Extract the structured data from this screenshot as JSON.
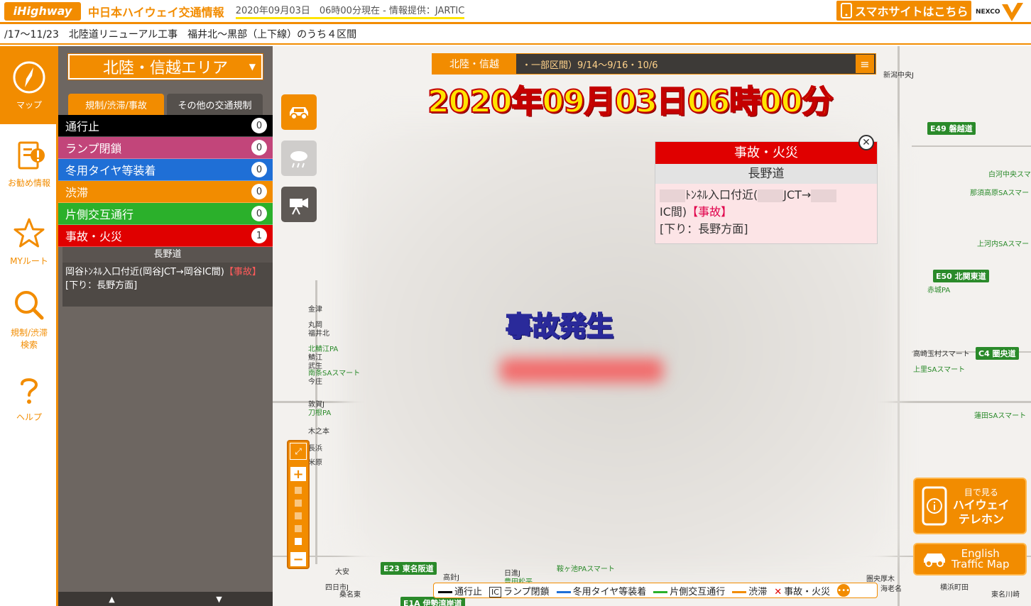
{
  "header": {
    "logo": "iHighway",
    "title": "中日本ハイウェイ交通情報",
    "timestamp": "2020年09月03日　06時00分現在 - 情報提供：JARTIC",
    "smartphone_link": "スマホサイトはこちら",
    "nexco": "NEXCO"
  },
  "ticker": {
    "text": "/17～11/23　北陸道リニューアル工事　福井北～黒部（上下線）のうち４区間"
  },
  "nav": {
    "items": [
      {
        "label": "マップ",
        "icon": "compass-icon"
      },
      {
        "label": "お勧め情報",
        "icon": "info-icon"
      },
      {
        "label": "MYルート",
        "icon": "star-icon"
      },
      {
        "label": "規制/渋滞\n検索",
        "icon": "search-icon"
      },
      {
        "label": "ヘルプ",
        "icon": "help-icon"
      }
    ]
  },
  "panel": {
    "area_label": "北陸・信越エリア",
    "tabs": [
      "規制/渋滞/事故",
      "その他の交通規制"
    ],
    "categories": [
      {
        "label": "通行止",
        "count": "0",
        "color": "#000000"
      },
      {
        "label": "ランプ閉鎖",
        "count": "0",
        "color": "#c2457a"
      },
      {
        "label": "冬用タイヤ等装着",
        "count": "0",
        "color": "#1f6fd6"
      },
      {
        "label": "渋滞",
        "count": "0",
        "color": "#f28c00"
      },
      {
        "label": "片側交互通行",
        "count": "0",
        "color": "#2bb02b"
      },
      {
        "label": "事故・火災",
        "count": "1",
        "color": "#e00000"
      }
    ],
    "incident": {
      "road": "長野道",
      "line1": "岡谷ﾄﾝﾈﾙ入口付近(岡谷JCT→岡谷IC間)",
      "tag": "【事故】",
      "line2": "[下り：長野方面]"
    },
    "scroll_up": "▲",
    "scroll_down": "▼"
  },
  "map": {
    "region_label": "北陸・信越",
    "region_text": "・一部区間）9/14～9/16・10/6",
    "big_time": "2020年09月03日06時00分",
    "accident_label": "事故発生",
    "popup": {
      "title": "事故・火災",
      "road": "長野道",
      "line1": "ﾄﾝﾈﾙ入口付近(",
      "line1b": "JCT→",
      "line2": "IC間)",
      "tag": "【事故】",
      "line3": "[下り：長野方面]"
    },
    "legend": {
      "closure": "通行止",
      "ramp_ic": "IC",
      "ramp": "ランプ閉鎖",
      "winter": "冬用タイヤ等装着",
      "alternate": "片側交互通行",
      "congestion": "渋滞",
      "accident": "事故・火災"
    },
    "telephone": {
      "line1": "目で見る",
      "line2": "ハイウェイ\nテレホン"
    },
    "english": {
      "line1": "English",
      "line2": "Traffic Map"
    },
    "labels": [
      {
        "text": "E49 磐越道"
      },
      {
        "text": "E50 北関東道"
      },
      {
        "text": "C4 圏央道"
      },
      {
        "text": "E23 東名阪道"
      },
      {
        "text": "E1A 伊勢湾岸道"
      },
      {
        "text": "新潟中央J"
      },
      {
        "text": "白河中央スマート"
      },
      {
        "text": "那須高原SAスマート"
      },
      {
        "text": "上河内SAスマート"
      },
      {
        "text": "赤城PA"
      },
      {
        "text": "高崎玉村スマート"
      },
      {
        "text": "上里SAスマート"
      },
      {
        "text": "蓮田SAスマート"
      },
      {
        "text": "金津"
      },
      {
        "text": "丸岡"
      },
      {
        "text": "福井北"
      },
      {
        "text": "北鯖江PA"
      },
      {
        "text": "鯖江"
      },
      {
        "text": "武生"
      },
      {
        "text": "南条SAスマート"
      },
      {
        "text": "今庄"
      },
      {
        "text": "敦賀J"
      },
      {
        "text": "刀根PA"
      },
      {
        "text": "木之本"
      },
      {
        "text": "長浜"
      },
      {
        "text": "米原"
      },
      {
        "text": "大安"
      },
      {
        "text": "四日市J"
      },
      {
        "text": "桑名東"
      },
      {
        "text": "日進J"
      },
      {
        "text": "高針J"
      },
      {
        "text": "豊田松平"
      },
      {
        "text": "鞍ヶ池PAスマート"
      },
      {
        "text": "圏央厚木"
      },
      {
        "text": "海老名"
      },
      {
        "text": "横浜町田"
      },
      {
        "text": "東名川崎"
      }
    ]
  },
  "colors": {
    "accent": "#f28c00",
    "accident": "#e00000",
    "panel_bg": "#6d6661"
  }
}
